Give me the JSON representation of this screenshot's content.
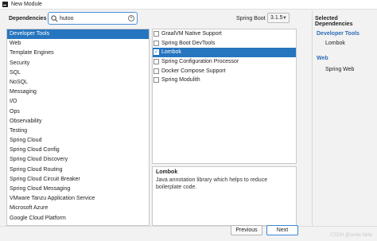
{
  "window": {
    "title": "New Module"
  },
  "header": {
    "dependencies_label": "Dependencies",
    "search": {
      "value": "hutoo",
      "placeholder": ""
    },
    "spring_boot_label": "Spring Boot",
    "spring_boot_version": "3.1.5"
  },
  "categories": [
    "Developer Tools",
    "Web",
    "Template Engines",
    "Security",
    "SQL",
    "NoSQL",
    "Messaging",
    "I/O",
    "Ops",
    "Observability",
    "Testing",
    "Spring Cloud",
    "Spring Cloud Config",
    "Spring Cloud Discovery",
    "Spring Cloud Routing",
    "Spring Cloud Circuit Breaker",
    "Spring Cloud Messaging",
    "VMware Tanzu Application Service",
    "Microsoft Azure",
    "Google Cloud Platform"
  ],
  "selected_category": "Developer Tools",
  "dependencies": [
    {
      "label": "GraalVM Native Support",
      "checked": false,
      "selected": false
    },
    {
      "label": "Spring Boot DevTools",
      "checked": false,
      "selected": false
    },
    {
      "label": "Lombok",
      "checked": true,
      "selected": true
    },
    {
      "label": "Spring Configuration Processor",
      "checked": false,
      "selected": false
    },
    {
      "label": "Docker Compose Support",
      "checked": false,
      "selected": false
    },
    {
      "label": "Spring Modulith",
      "checked": false,
      "selected": false
    }
  ],
  "description": {
    "title": "Lombok",
    "text": "Java annotation library which helps to reduce boilerplate code."
  },
  "selected_dependencies": {
    "header": "Selected Dependencies",
    "groups": [
      {
        "name": "Developer Tools",
        "items": [
          "Lombok"
        ]
      },
      {
        "name": "Web",
        "items": [
          "Spring Web"
        ]
      }
    ]
  },
  "footer": {
    "previous": "Previous",
    "next": "Next",
    "watermark": "CSDN @smile Nida"
  },
  "colors": {
    "accent": "#2675bf",
    "group_title": "#2d6db5"
  }
}
